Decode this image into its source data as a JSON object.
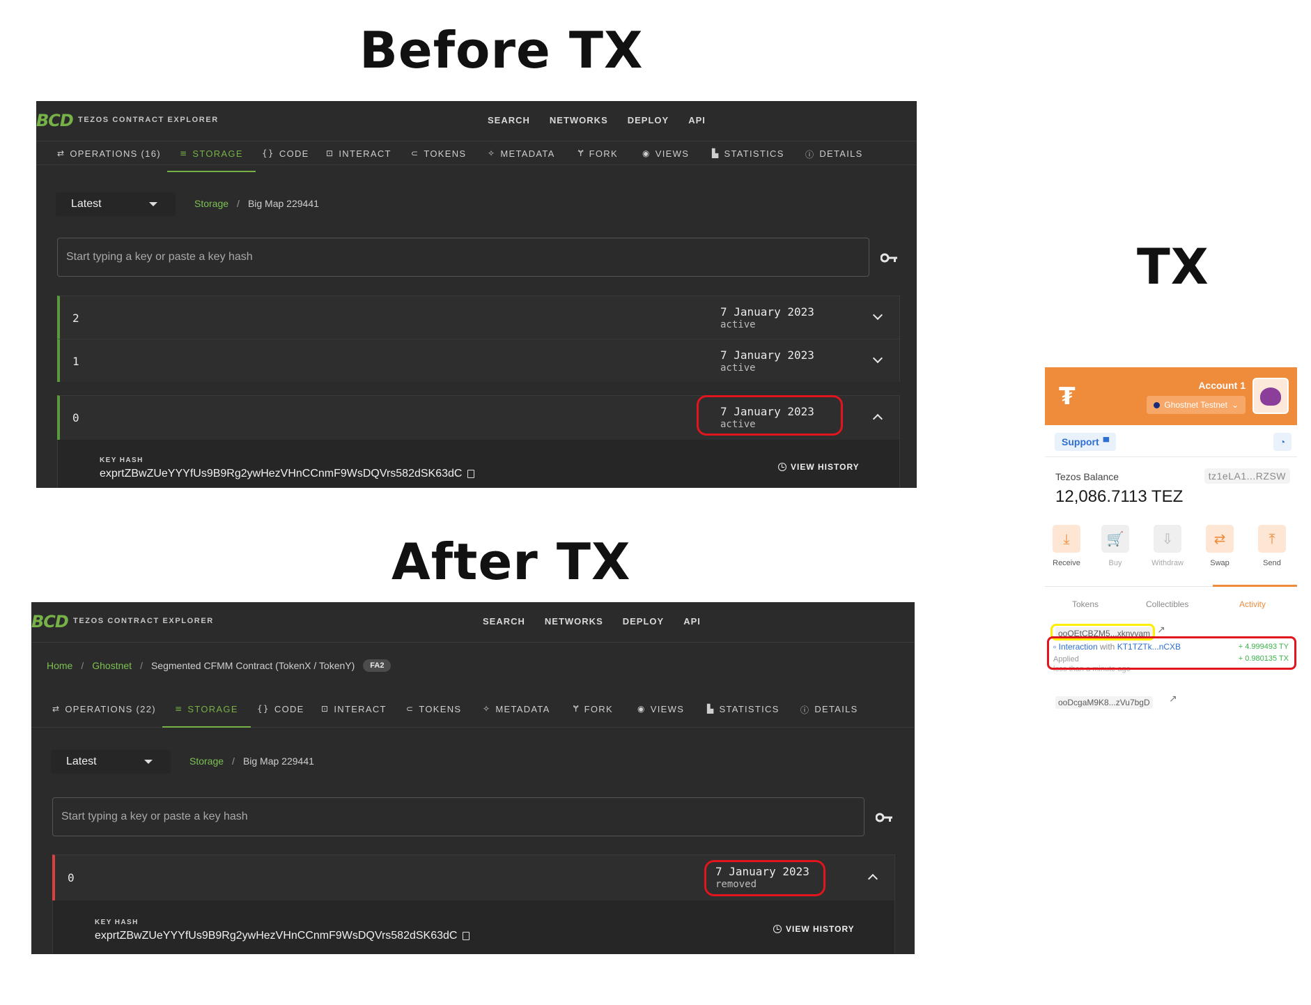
{
  "headings": {
    "before": "Before TX",
    "after": "After TX",
    "tx": "TX"
  },
  "bcd": {
    "logo": "BCD",
    "logo_text": "TEZOS CONTRACT EXPLORER",
    "topnav": [
      "SEARCH",
      "NETWORKS",
      "DEPLOY",
      "API"
    ]
  },
  "before": {
    "tabs": [
      {
        "icon": "⇄",
        "label": "OPERATIONS (16)"
      },
      {
        "icon": "≡",
        "label": "STORAGE"
      },
      {
        "icon": "{}",
        "label": "CODE"
      },
      {
        "icon": "⊡",
        "label": "INTERACT"
      },
      {
        "icon": "⊂",
        "label": "TOKENS"
      },
      {
        "icon": "✧",
        "label": "METADATA"
      },
      {
        "icon": "Ɏ",
        "label": "FORK"
      },
      {
        "icon": "◉",
        "label": "VIEWS"
      },
      {
        "icon": "▙",
        "label": "STATISTICS"
      },
      {
        "icon": "ⓘ",
        "label": "DETAILS"
      }
    ],
    "select_value": "Latest",
    "path": {
      "link": "Storage",
      "current": "Big Map 229441"
    },
    "search_placeholder": "Start typing a key or paste a key hash",
    "rows": [
      {
        "key": "2",
        "date": "7 January 2023",
        "status": "active"
      },
      {
        "key": "1",
        "date": "7 January 2023",
        "status": "active"
      },
      {
        "key": "0",
        "date": "7 January 2023",
        "status": "active"
      }
    ],
    "key_hash_label": "KEY HASH",
    "key_hash": "exprtZBwZUeYYYfUs9B9Rg2ywHezVHnCCnmF9WsDQVrs582dSK63dC",
    "view_history": "VIEW HISTORY"
  },
  "after": {
    "breadcrumb": {
      "home": "Home",
      "network": "Ghostnet",
      "contract": "Segmented CFMM Contract (TokenX / TokenY)",
      "badge": "FA2"
    },
    "tabs": [
      {
        "icon": "⇄",
        "label": "OPERATIONS (22)"
      },
      {
        "icon": "≡",
        "label": "STORAGE"
      },
      {
        "icon": "{}",
        "label": "CODE"
      },
      {
        "icon": "⊡",
        "label": "INTERACT"
      },
      {
        "icon": "⊂",
        "label": "TOKENS"
      },
      {
        "icon": "✧",
        "label": "METADATA"
      },
      {
        "icon": "Ɏ",
        "label": "FORK"
      },
      {
        "icon": "◉",
        "label": "VIEWS"
      },
      {
        "icon": "▙",
        "label": "STATISTICS"
      },
      {
        "icon": "ⓘ",
        "label": "DETAILS"
      }
    ],
    "select_value": "Latest",
    "path": {
      "link": "Storage",
      "current": "Big Map 229441"
    },
    "search_placeholder": "Start typing a key or paste a key hash",
    "row": {
      "key": "0",
      "date": "7 January 2023",
      "status": "removed"
    },
    "key_hash_label": "KEY HASH",
    "key_hash": "exprtZBwZUeYYYfUs9B9Rg2ywHezVHnCCnmF9WsDQVrs582dSK63dC",
    "view_history": "VIEW HISTORY"
  },
  "wallet": {
    "account": "Account 1",
    "network": "Ghostnet Testnet",
    "support": "Support",
    "balance_label": "Tezos Balance",
    "address": "tz1eLA1...RZSW",
    "balance": "12,086.7113 TEZ",
    "actions": [
      {
        "icon": "⤓",
        "label": "Receive",
        "enabled": true
      },
      {
        "icon": "🛒",
        "label": "Buy",
        "enabled": false
      },
      {
        "icon": "⇩",
        "label": "Withdraw",
        "enabled": false
      },
      {
        "icon": "⇄",
        "label": "Swap",
        "enabled": true
      },
      {
        "icon": "⤒",
        "label": "Send",
        "enabled": true
      }
    ],
    "tabs": [
      "Tokens",
      "Collectibles",
      "Activity"
    ],
    "activity": {
      "hash1": "ooQEtCBZM5...xknvvam",
      "interaction_prefix": "Interaction",
      "interaction_with": "with",
      "interaction_target": "KT1TZTk...nCXB",
      "amount1": "+ 4.999493 TY",
      "amount2": "+ 0.980135 TX",
      "status": "Applied",
      "time": "less than a minute ago",
      "hash2": "ooDcgaM9K8...zVu7bgD"
    }
  }
}
